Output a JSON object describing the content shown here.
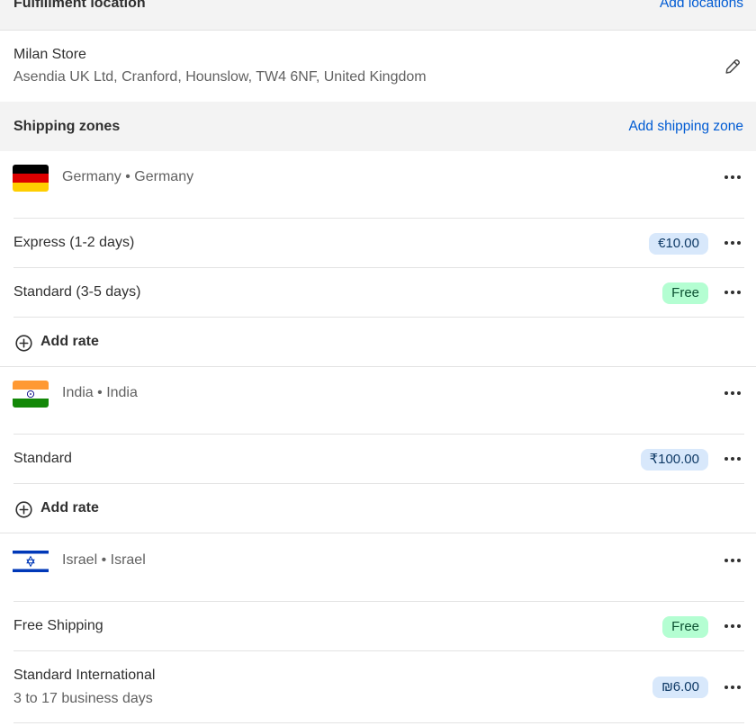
{
  "fulfillment": {
    "title": "Fulfillment location",
    "add_link": "Add locations",
    "location_name": "Milan Store",
    "location_address": "Asendia UK Ltd, Cranford, Hounslow, TW4 6NF, United Kingdom"
  },
  "shipping": {
    "title": "Shipping zones",
    "add_link": "Add shipping zone",
    "add_rate_label": "Add rate",
    "zones": [
      {
        "name": "Germany • Germany",
        "flag": "germany-flag",
        "rates": [
          {
            "label": "Express (1-2 days)",
            "price": "€10.00"
          },
          {
            "label": "Standard (3-5 days)",
            "price": "Free"
          }
        ]
      },
      {
        "name": "India • India",
        "flag": "india-flag",
        "rates": [
          {
            "label": "Standard",
            "price": "₹100.00"
          }
        ]
      },
      {
        "name": "Israel • Israel",
        "flag": "israel-flag",
        "rates": [
          {
            "label": "Free Shipping",
            "price": "Free"
          },
          {
            "label": "Standard International",
            "sublabel": "3 to 17 business days",
            "price": "₪6.00"
          }
        ]
      }
    ]
  },
  "colors": {
    "link": "#005bd3",
    "paid_badge_bg": "#d8e8fb",
    "free_badge_bg": "#b4fed2",
    "section_bg": "#f3f3f3"
  }
}
